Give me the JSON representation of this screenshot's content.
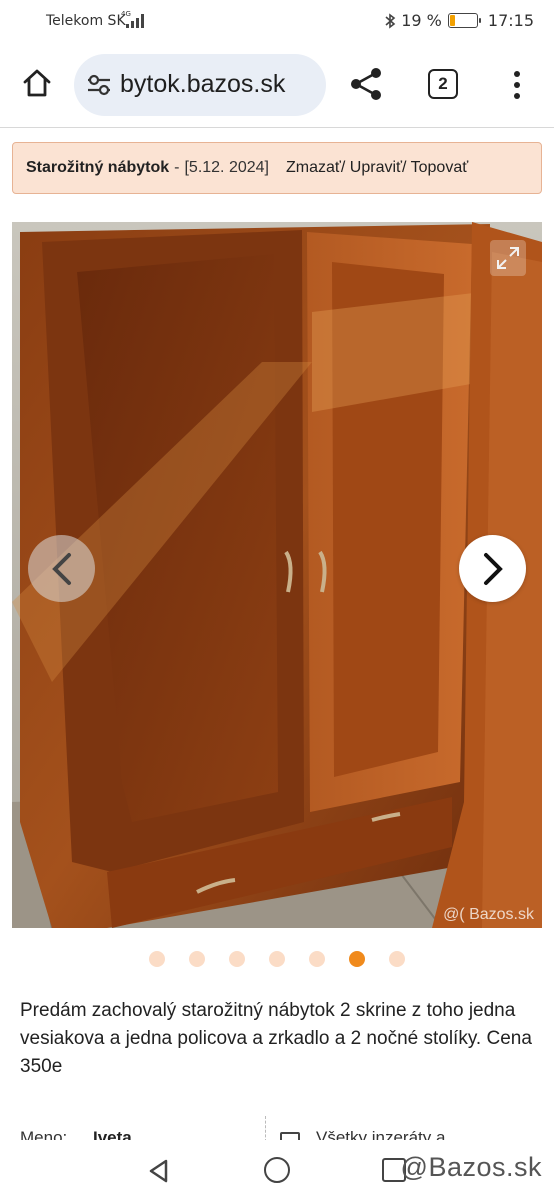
{
  "status_bar": {
    "carrier": "Telekom SK",
    "network_type": "4G",
    "battery_percent": "19 %",
    "battery_level": 0.19,
    "time": "17:15"
  },
  "browser": {
    "url": "bytok.bazos.sk",
    "tab_count": "2"
  },
  "ad": {
    "category": "Starožitný nábytok",
    "separator": "-",
    "date": "[5.12. 2024]",
    "actions": [
      "Zmazať",
      "Upraviť",
      "Topovať"
    ]
  },
  "gallery": {
    "watermark": "@( Bazos.sk",
    "image_count": 7,
    "active_index": 5
  },
  "description": "Predám zachovalý starožitný nábytok 2 skrine z toho jedna vesiakova a jedna policova a zrkadlo a 2 nočné stolíky. Cena 350e",
  "seller": {
    "name_label": "Meno:",
    "name": "Iveta",
    "all_ads_label": "Všetky inzeráty a"
  },
  "nav_bar": {
    "watermark": "@Bazos.sk"
  },
  "colors": {
    "ad_header_bg": "#fbe3d3",
    "ad_header_border": "#e7b394",
    "dot_inactive": "#fbdcc6",
    "dot_active": "#f08a1c",
    "url_pill_bg": "#e9eef6"
  }
}
